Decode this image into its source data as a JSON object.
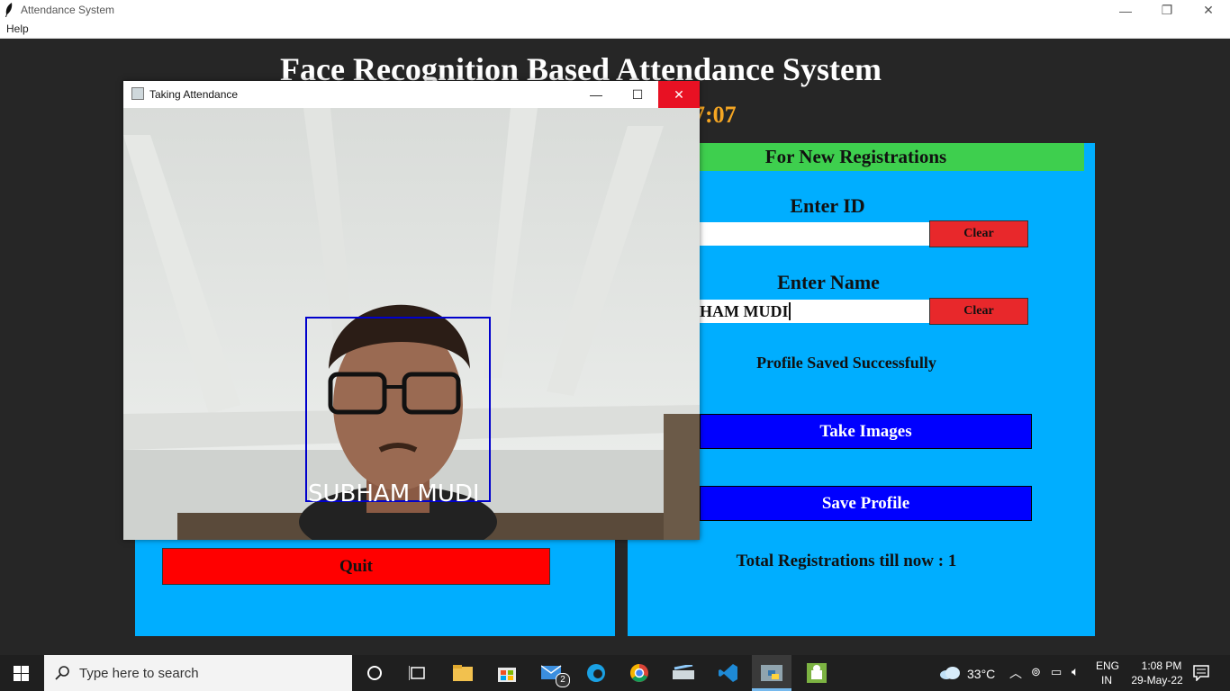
{
  "window": {
    "title": "Attendance System",
    "minimize": "—",
    "restore": "❐",
    "close": "✕"
  },
  "menu": {
    "help": "Help"
  },
  "app": {
    "title": "Face Recognition Based Attendance System",
    "clock": "7:07"
  },
  "registration": {
    "header": "For New Registrations",
    "id_label": "Enter ID",
    "id_value": "",
    "name_label": "Enter Name",
    "name_value": "HAM MUDI",
    "clear_label": "Clear",
    "status_message": "Profile Saved Successfully",
    "take_images_label": "Take Images",
    "save_profile_label": "Save Profile",
    "total_text": "Total Registrations till now  : 1"
  },
  "attendance": {
    "quit_label": "Quit"
  },
  "camera_window": {
    "title": "Taking Attendance",
    "minimize": "—",
    "maximize": "☐",
    "close": "✕",
    "face_label": "SUBHAM  MUDI",
    "box_color": "#0000cc"
  },
  "taskbar": {
    "search_placeholder": "Type here to search",
    "mail_badge": "2",
    "weather": "33°C",
    "lang_top": "ENG",
    "lang_bottom": "IN",
    "time": "1:08 PM",
    "date": "29-May-22"
  },
  "colors": {
    "panel": "#00aeff",
    "header_green": "#3ecf4e",
    "clear_red": "#e8282b",
    "action_blue": "#0000ff",
    "quit_red": "#ff0000",
    "clock_orange": "#f5a623"
  }
}
